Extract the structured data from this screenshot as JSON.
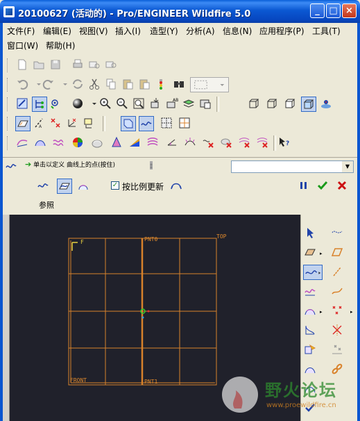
{
  "window": {
    "title": "20100627 (活动的) - Pro/ENGINEER Wildfire 5.0",
    "minimize_label": "_",
    "maximize_label": "□",
    "close_label": "×"
  },
  "menu": {
    "items": [
      {
        "label": "文件(F)"
      },
      {
        "label": "编辑(E)"
      },
      {
        "label": "视图(V)"
      },
      {
        "label": "插入(I)"
      },
      {
        "label": "造型(Y)"
      },
      {
        "label": "分析(A)"
      },
      {
        "label": "信息(N)"
      },
      {
        "label": "应用程序(P)"
      },
      {
        "label": "工具(T)"
      },
      {
        "label": "窗口(W)"
      },
      {
        "label": "帮助(H)"
      }
    ]
  },
  "dashboard": {
    "prompt": "单击以定义 曲线上的点(按住)",
    "scale_checkbox_label": "按比例更新",
    "scale_checked": true,
    "reference_tab": "参照"
  },
  "graphics": {
    "labels": {
      "top_left_glyph": "F",
      "pnt0": "PNT0",
      "top": "TOP",
      "front": "FRONT",
      "pnt1": "PNT1"
    }
  },
  "watermark": {
    "title": "野火论坛",
    "url": "www.proewildfire.cn"
  },
  "colors": {
    "titlebar": "#0b58d2",
    "graphics_bg": "#20212b",
    "grid_lines": "#d9822b",
    "accent_green": "#1a9a1a",
    "accent_red": "#cc1111",
    "accent_blue": "#2244aa"
  }
}
